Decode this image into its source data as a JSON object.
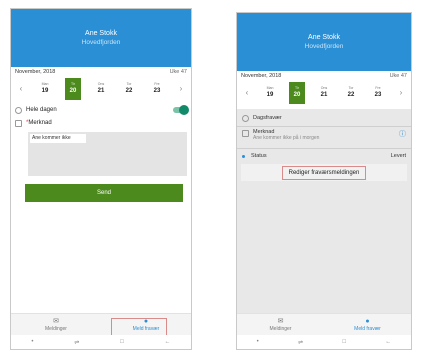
{
  "screen1": {
    "name": "Ane Stokk",
    "subtitle": "Hovedfjorden",
    "month": "November, 2018",
    "week": "Uke 47",
    "days": [
      {
        "dn": "Man",
        "dd": "19"
      },
      {
        "dn": "Tir",
        "dd": "20"
      },
      {
        "dn": "Ons",
        "dd": "21"
      },
      {
        "dn": "Tor",
        "dd": "22"
      },
      {
        "dn": "Fre",
        "dd": "23"
      }
    ],
    "allday_label": "Hele dagen",
    "note_label": "Merknad",
    "note_required": "*",
    "note_value": "Ane kommer ikke",
    "send_label": "Send",
    "tab_messages": "Meldinger",
    "tab_report": "Meld fravær"
  },
  "screen2": {
    "name": "Ane Stokk",
    "subtitle": "Hovedfjorden",
    "month": "November, 2018",
    "week": "Uke 47",
    "days": [
      {
        "dn": "Man",
        "dd": "19"
      },
      {
        "dn": "Tir",
        "dd": "20"
      },
      {
        "dn": "Ons",
        "dd": "21"
      },
      {
        "dn": "Tor",
        "dd": "22"
      },
      {
        "dn": "Fre",
        "dd": "23"
      }
    ],
    "absence_type": "Dagsfravær",
    "note_label": "Merknad",
    "note_value": "Ane kommer ikke på i morgen",
    "status_label": "Status",
    "status_value": "Levert",
    "edit_label": "Rediger fraværsmeldingen",
    "tab_messages": "Meldinger",
    "tab_report": "Meld fravær"
  },
  "icons": {
    "left": "chevron-left-icon",
    "right": "chevron-right-icon",
    "clock": "clock-icon",
    "note": "note-icon",
    "info": "info-icon",
    "mail": "mail-icon",
    "report": "report-icon"
  },
  "colors": {
    "header": "#2b8fd6",
    "selected_day": "#4c8a1d",
    "send_button": "#4c8a1d",
    "toggle": "#118a69",
    "highlight": "#d98a8a"
  }
}
